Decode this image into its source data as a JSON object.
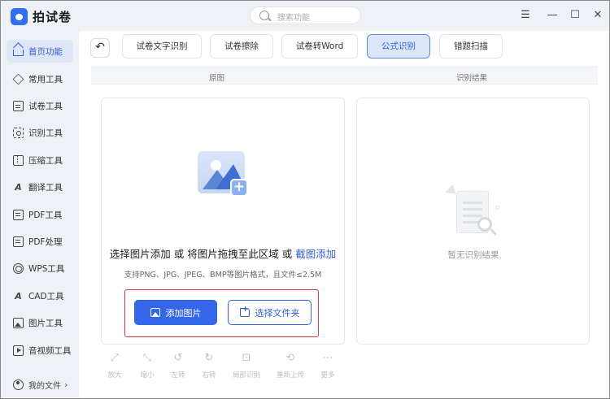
{
  "app": {
    "title": "拍试卷"
  },
  "search": {
    "placeholder": "搜索功能"
  },
  "window_controls": {
    "menu": "☰",
    "minimize": "—",
    "maximize": "☐",
    "close": "✕"
  },
  "sidebar": {
    "items": [
      {
        "label": "首页功能",
        "icon": "home-icon",
        "active": true
      },
      {
        "label": "常用工具",
        "icon": "layers-icon"
      },
      {
        "label": "试卷工具",
        "icon": "paper-icon"
      },
      {
        "label": "识别工具",
        "icon": "scan-icon"
      },
      {
        "label": "压缩工具",
        "icon": "compress-icon"
      },
      {
        "label": "翻译工具",
        "icon": "translate-icon"
      },
      {
        "label": "PDF工具",
        "icon": "pdf-icon"
      },
      {
        "label": "PDF处理",
        "icon": "pdf-process-icon"
      },
      {
        "label": "WPS工具",
        "icon": "wps-icon"
      },
      {
        "label": "CAD工具",
        "icon": "cad-icon"
      },
      {
        "label": "图片工具",
        "icon": "image-icon"
      },
      {
        "label": "音视频工具",
        "icon": "media-icon"
      }
    ],
    "my_files": {
      "label": "我的文件",
      "chevron": "›"
    }
  },
  "main": {
    "back": "↶",
    "tabs": [
      {
        "label": "试卷文字识别"
      },
      {
        "label": "试卷擦除"
      },
      {
        "label": "试卷转Word"
      },
      {
        "label": "公式识别",
        "active": true
      },
      {
        "label": "错题扫描"
      }
    ],
    "col_headers": {
      "left": "原图",
      "right": "识别结果"
    },
    "upload": {
      "line_part1": "选择图片添加 或 将图片拖拽至此区域 或 ",
      "line_link": "截图添加",
      "hint": "支持PNG、JPG、JPEG、BMP等图片格式，且文件≤2.5M",
      "add_image": "添加图片",
      "choose_folder": "选择文件夹"
    },
    "result": {
      "empty_text": "暂无识别结果"
    },
    "toolbar": [
      {
        "label": "放大",
        "icon": "expand-icon",
        "glyph": "⤢"
      },
      {
        "label": "缩小",
        "icon": "shrink-icon",
        "glyph": "⤡"
      },
      {
        "label": "左转",
        "icon": "rotate-left-icon",
        "glyph": "↺"
      },
      {
        "label": "右转",
        "icon": "rotate-right-icon",
        "glyph": "↻"
      },
      {
        "label": "局部识别",
        "icon": "crop-icon",
        "glyph": "⊡"
      },
      {
        "label": "重新上传",
        "icon": "reupload-icon",
        "glyph": "⟲"
      },
      {
        "label": "更多",
        "icon": "more-icon",
        "glyph": "⋯"
      }
    ]
  }
}
